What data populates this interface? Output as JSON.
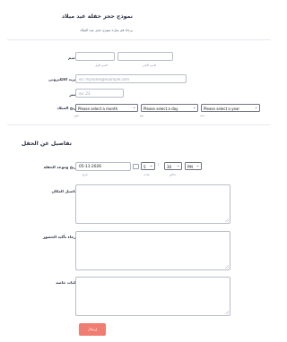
{
  "header": {
    "title": "نموذج حجز حفلة عيد ميلاد",
    "subtitle": "يرجاء قم بملء نموذج حجز عيد الميلاد"
  },
  "name": {
    "label": "الاسم",
    "first_sublabel": "الاسم الأول",
    "last_sublabel": "الاسم الأخير",
    "first_value": "",
    "last_value": ""
  },
  "email": {
    "label": "البريد الالكتروني",
    "placeholder": "ex: myname@example.com"
  },
  "age": {
    "label": "العمر",
    "placeholder": "ex: 23"
  },
  "birthdate": {
    "label": "تاريخ الميلاد",
    "month_value": "Please select a month",
    "day_value": "Please select a day",
    "year_value": "Please select a year",
    "month_sublabel": "شهر",
    "day_sublabel": "يوم",
    "year_sublabel": "سنة"
  },
  "party_section": {
    "heading": "تفاصيل عن الحفل"
  },
  "party_datetime": {
    "label": "تاريخ وموعد الحفلة",
    "date_value": "05-11-2026",
    "date_sublabel": "تاريخ",
    "hour_value": "5",
    "minute_value": "30",
    "ampm_value": "PM",
    "hour_sublabel": "ساعة",
    "minute_sublabel": "دقائق"
  },
  "venue_details": {
    "label": "تفاصيل المكان"
  },
  "attendance": {
    "label": "الرجاء تأكيد الحضور"
  },
  "special_requests": {
    "label": "طلبات خاصة"
  },
  "submit": {
    "label": "إرسال"
  },
  "colors": {
    "submit_bg": "#ef7d72",
    "border": "#b8bdc9",
    "text": "#2c3345"
  },
  "icons": [
    "calendar-icon",
    "chevron-down-icon",
    "resize-grip-icon"
  ]
}
